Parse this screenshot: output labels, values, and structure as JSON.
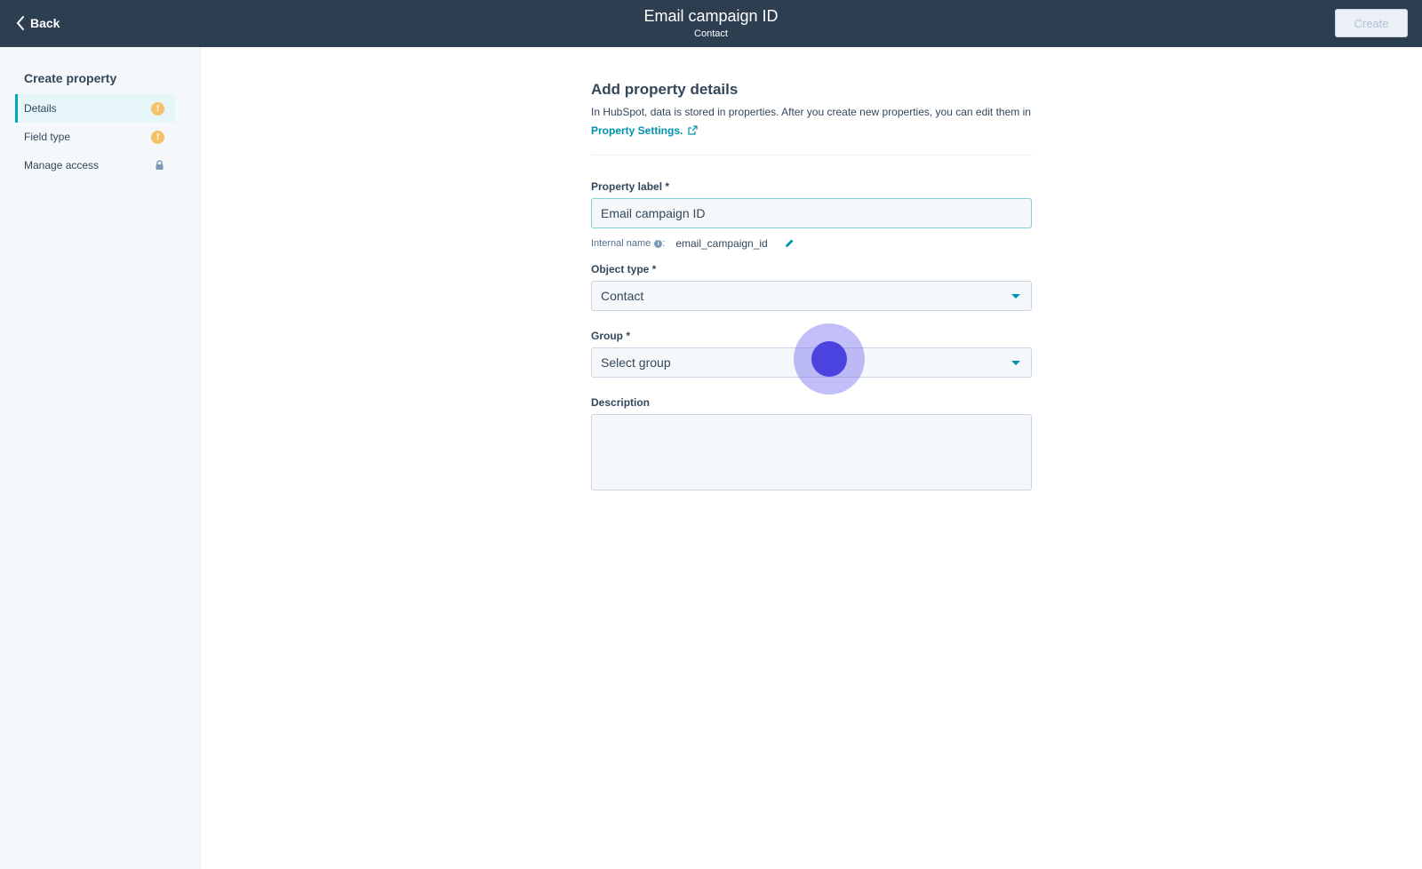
{
  "header": {
    "back_label": "Back",
    "title": "Email campaign ID",
    "subtitle": "Contact",
    "create_label": "Create"
  },
  "sidebar": {
    "title": "Create property",
    "items": [
      {
        "label": "Details",
        "status_icon": "warning-icon",
        "active": true
      },
      {
        "label": "Field type",
        "status_icon": "warning-icon",
        "active": false
      },
      {
        "label": "Manage access",
        "status_icon": "lock-icon",
        "active": false
      }
    ]
  },
  "main": {
    "heading": "Add property details",
    "intro_text": "In HubSpot, data is stored in properties. After you create new properties, you can edit them in",
    "intro_link": "Property Settings.",
    "property_label": {
      "label": "Property label *",
      "value": "Email campaign ID"
    },
    "internal_name": {
      "label": "Internal name",
      "value": "email_campaign_id"
    },
    "object_type": {
      "label": "Object type *",
      "value": "Contact"
    },
    "group": {
      "label": "Group *",
      "placeholder": "Select group"
    },
    "description": {
      "label": "Description",
      "value": ""
    }
  },
  "colors": {
    "topbar": "#2d3e50",
    "accent": "#00a4bd",
    "link": "#0091ae",
    "warning": "#f5c26b",
    "click_indicator": "#4a43e0"
  }
}
